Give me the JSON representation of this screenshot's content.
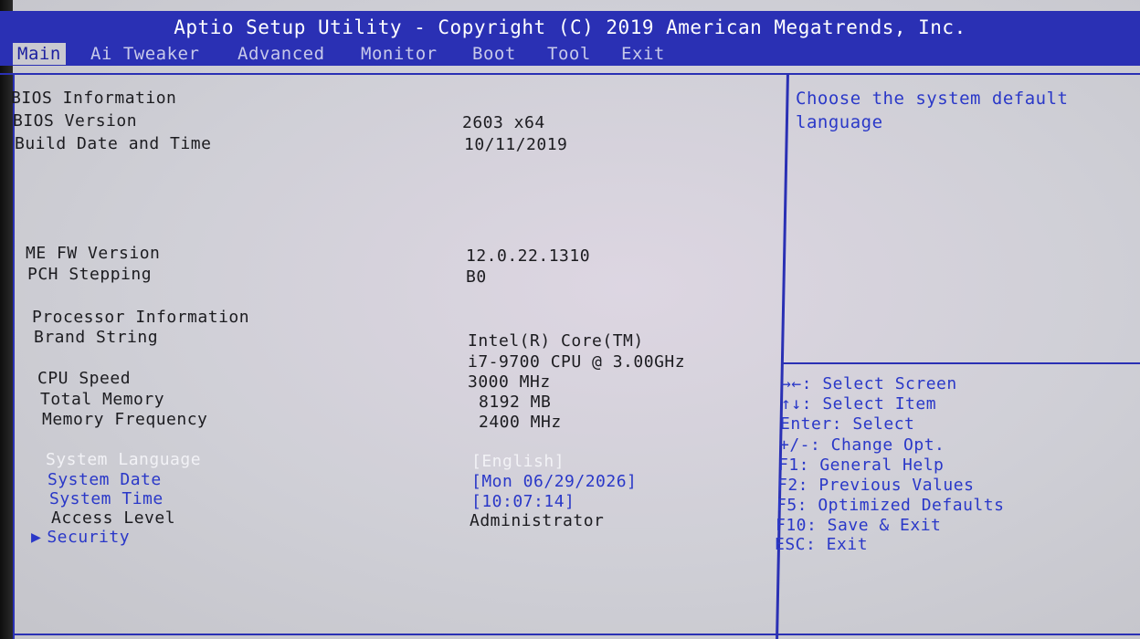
{
  "title": "Aptio Setup Utility - Copyright (C) 2019 American Megatrends, Inc.",
  "tabs": [
    "Main",
    "Ai Tweaker",
    "Advanced",
    "Monitor",
    "Boot",
    "Tool",
    "Exit"
  ],
  "main": {
    "bios_info_header": "BIOS Information",
    "bios_version_label": "BIOS Version",
    "bios_version_value": "2603  x64",
    "build_date_label": "Build Date and Time",
    "build_date_value": "10/11/2019",
    "me_fw_label": "ME FW Version",
    "me_fw_value": "12.0.22.1310",
    "pch_label": "PCH Stepping",
    "pch_value": "B0",
    "proc_header": "Processor Information",
    "brand_label": "Brand String",
    "brand_value_1": "Intel(R) Core(TM)",
    "brand_value_2": "i7-9700 CPU @ 3.00GHz",
    "cpu_speed_label": "CPU Speed",
    "cpu_speed_value": "3000 MHz",
    "total_mem_label": "Total Memory",
    "total_mem_value": "8192 MB",
    "mem_freq_label": "Memory Frequency",
    "mem_freq_value": "2400 MHz",
    "sys_lang_label": "System Language",
    "sys_lang_value": "[English]",
    "sys_date_label": "System Date",
    "sys_date_value": "[Mon 06/29/2026]",
    "sys_time_label": "System Time",
    "sys_time_value": "[10:07:14]",
    "access_label": "Access Level",
    "access_value": "Administrator",
    "security_label": "Security"
  },
  "help": {
    "description": "Choose the system default language",
    "keys": [
      "→←: Select Screen",
      "↑↓: Select Item",
      "Enter: Select",
      "+/-: Change Opt.",
      "F1: General Help",
      "F2: Previous Values",
      "F5: Optimized Defaults",
      "F10: Save & Exit",
      "ESC: Exit"
    ]
  },
  "icons": {
    "submenu_arrow": "▶"
  },
  "colors": {
    "header_blue": "#2a30b4",
    "accent_blue": "#2a38c8",
    "panel_gray": "#d0d0d6"
  }
}
